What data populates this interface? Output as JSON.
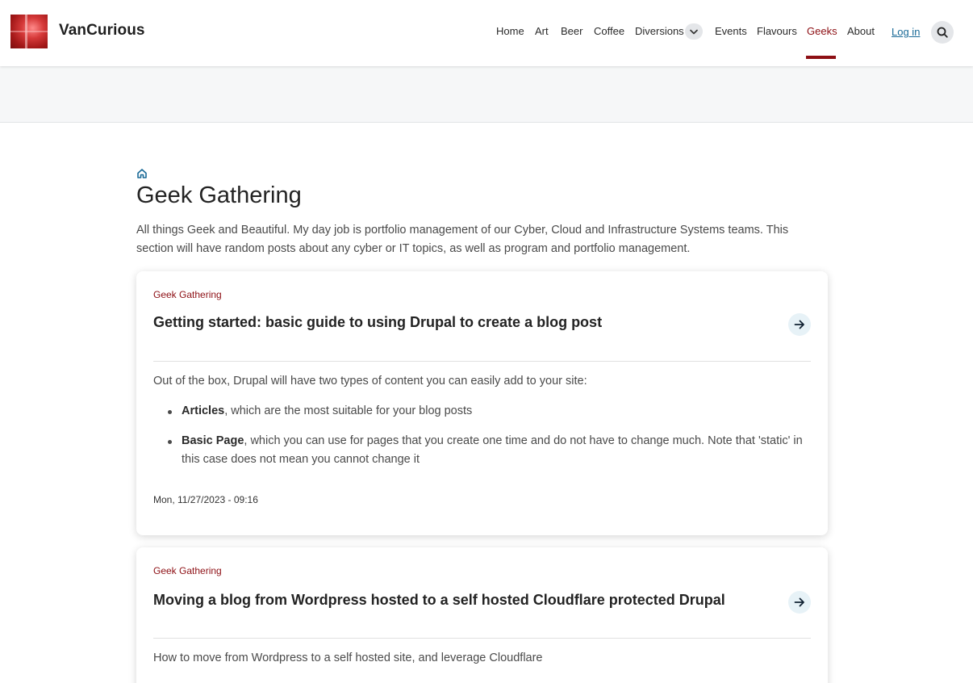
{
  "site": {
    "name": "VanCurious"
  },
  "nav": {
    "items": [
      "Home",
      "Art",
      "Beer",
      "Coffee",
      "Diversions",
      "Events",
      "Flavours",
      "Geeks",
      "About"
    ],
    "active": "Geeks",
    "login": "Log in"
  },
  "colors": {
    "accent": "#8d0f14",
    "link": "#1a6a97",
    "band": "#f6f7f8"
  },
  "page": {
    "title": "Geek Gathering",
    "intro": "All things Geek and Beautiful.   My day job is portfolio management of our Cyber, Cloud and Infrastructure Systems teams.  This section will have random posts about any cyber or IT topics, as well as program and portfolio management."
  },
  "cards": [
    {
      "category": "Geek Gathering",
      "title": "Getting started: basic guide to using Drupal to create a blog post",
      "body_intro": "Out of the box, Drupal will have two types of content you can easily add to your site:",
      "bullets": [
        {
          "bold": "Articles",
          "text": ", which are the most suitable for your blog posts"
        },
        {
          "bold": "Basic Page",
          "text": ", which you can use for pages that you create one time and do not have to change much.  Note that 'static' in this case does not mean you cannot change it"
        }
      ],
      "date": "Mon, 11/27/2023 - 09:16"
    },
    {
      "category": "Geek Gathering",
      "title": "Moving a blog from Wordpress hosted to a self hosted Cloudflare protected Drupal",
      "body_intro": "How to move from Wordpress to a self hosted site, and leverage Cloudflare"
    }
  ],
  "icons": {
    "home": "home-icon",
    "dropdown": "chevron-down-icon",
    "search": "search-icon",
    "arrow": "arrow-right-icon"
  }
}
